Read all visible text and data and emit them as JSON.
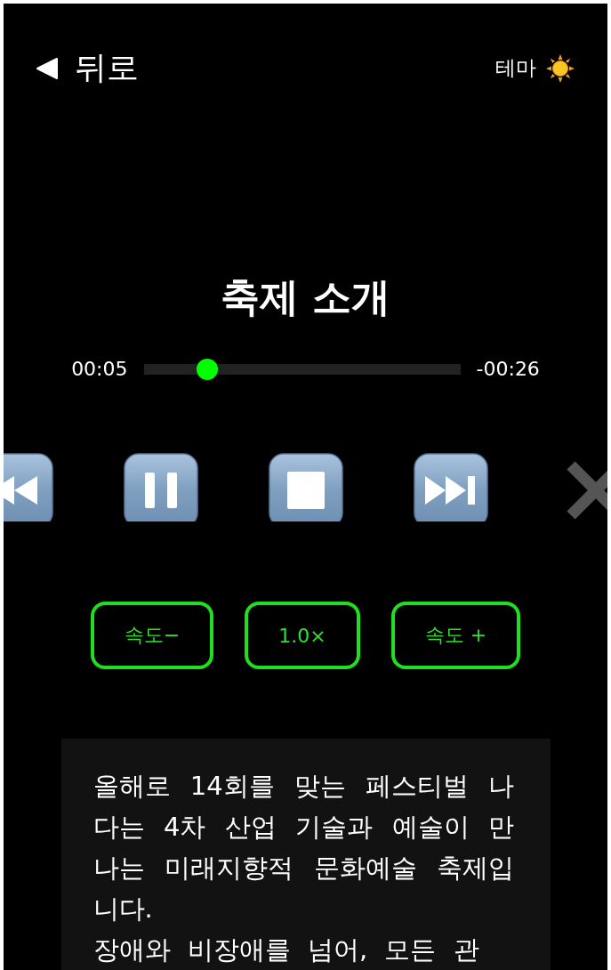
{
  "header": {
    "back_label": "뒤로",
    "theme_label": "테마"
  },
  "title": "축제 소개",
  "player": {
    "elapsed": "00:05",
    "remaining": "-00:26",
    "level": 0.2
  },
  "controls": [
    {
      "kind": "rewind"
    },
    {
      "kind": "pause"
    },
    {
      "kind": "stop"
    },
    {
      "kind": "forward"
    },
    {
      "kind": "close"
    }
  ],
  "speed_buttons": [
    {
      "label": "속도−"
    },
    {
      "label": "1.0×"
    },
    {
      "label": "속도 +"
    }
  ],
  "description": [
    "올해로 14회를 맞는 페스티벌 나다는 4차 산업 기술과 예술이 만나는 미래지향적 문화예술 축제입니다.",
    "장애와 비장애를 넘어, 모든 관"
  ]
}
